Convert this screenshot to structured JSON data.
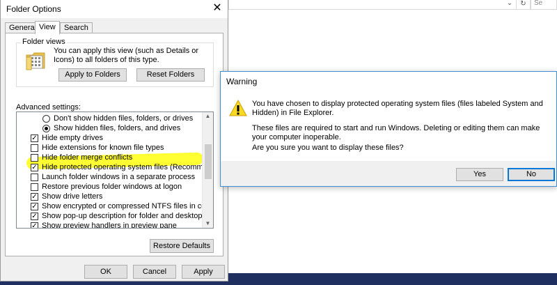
{
  "folder_options": {
    "title": "Folder Options",
    "close_glyph": "✕",
    "tabs": [
      "General",
      "View",
      "Search"
    ],
    "folder_views": {
      "label": "Folder views",
      "description": "You can apply this view (such as Details or Icons) to all folders of this type.",
      "apply_button": "Apply to Folders",
      "reset_button": "Reset Folders"
    },
    "advanced": {
      "label": "Advanced settings:",
      "items": [
        {
          "kind": "radio",
          "checked": false,
          "label": "Don't show hidden files, folders, or drives"
        },
        {
          "kind": "radio",
          "checked": true,
          "label": "Show hidden files, folders, and drives"
        },
        {
          "kind": "checkbox",
          "checked": true,
          "label": "Hide empty drives"
        },
        {
          "kind": "checkbox",
          "checked": false,
          "label": "Hide extensions for known file types"
        },
        {
          "kind": "checkbox",
          "checked": false,
          "label": "Hide folder merge conflicts"
        },
        {
          "kind": "checkbox",
          "checked": true,
          "label": "Hide protected operating system files (Recommended)"
        },
        {
          "kind": "checkbox",
          "checked": false,
          "label": "Launch folder windows in a separate process"
        },
        {
          "kind": "checkbox",
          "checked": false,
          "label": "Restore previous folder windows at logon"
        },
        {
          "kind": "checkbox",
          "checked": true,
          "label": "Show drive letters"
        },
        {
          "kind": "checkbox",
          "checked": true,
          "label": "Show encrypted or compressed NTFS files in color"
        },
        {
          "kind": "checkbox",
          "checked": true,
          "label": "Show pop-up description for folder and desktop items"
        },
        {
          "kind": "checkbox",
          "checked": true,
          "label": "Show preview handlers in preview pane"
        }
      ],
      "restore_button": "Restore Defaults"
    },
    "buttons": {
      "ok": "OK",
      "cancel": "Cancel",
      "apply": "Apply"
    }
  },
  "warning": {
    "title": "Warning",
    "line1": "You have chosen to display protected operating system files (files labeled System and Hidden) in File Explorer.",
    "line2": "These files are required to start and run Windows. Deleting or editing them can make your computer inoperable.",
    "line3": "Are you sure you want to display these files?",
    "yes": "Yes",
    "no": "No"
  },
  "explorer_bg": {
    "chevron_glyph": "⌄",
    "refresh_glyph": "↻",
    "search_placeholder": "Se"
  },
  "colors": {
    "accent": "#0078d7",
    "highlight": "#ffff33",
    "taskbar": "#1f3060",
    "warning_icon": "#f9d923"
  }
}
